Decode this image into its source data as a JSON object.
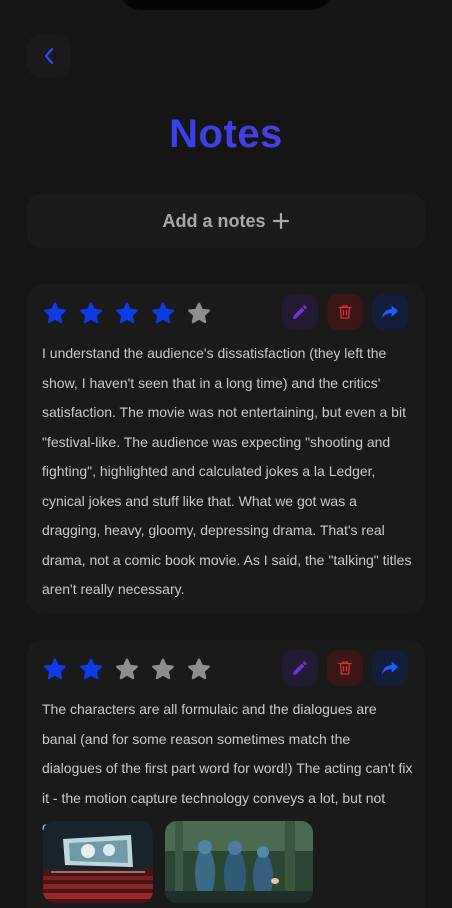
{
  "header": {
    "title": "Notes"
  },
  "add_button": {
    "label": "Add a notes"
  },
  "colors": {
    "star_filled": "#0f3be6",
    "star_empty": "#8e8e8e",
    "edit_icon": "#7c2fd9",
    "delete_icon": "#d23232",
    "share_icon": "#1f5cff",
    "back_icon": "#2a4bff"
  },
  "notes": [
    {
      "rating": 4,
      "max_rating": 5,
      "text": "I understand the audience's dissatisfaction (they left the show, I haven't seen that in a long time) and the critics' satisfaction. The movie was not entertaining, but even a bit \"festival-like. The audience was expecting \"shooting and fighting\", highlighted and calculated jokes a la Ledger, cynical jokes and stuff like that. What we got was a dragging, heavy, gloomy, depressing drama. That's real drama, not a comic book movie. As I said, the \"talking\" titles aren't really necessary."
    },
    {
      "rating": 2,
      "max_rating": 5,
      "text": "The characters are all formulaic and the dialogues are banal (and for some reason sometimes match the dialogues of the first part word for word!) The acting can't fix it - the motion capture technology conveys a lot, but not everything."
    }
  ]
}
